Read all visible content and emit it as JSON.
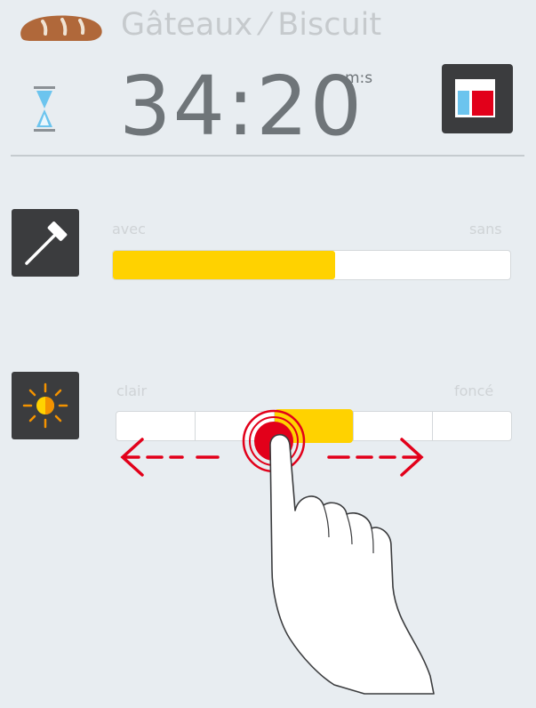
{
  "header": {
    "program_icon": "bread-icon",
    "program_title": "Gâteaux ⁄ Biscuit"
  },
  "timer": {
    "icon": "hourglass-icon",
    "value": "34:20",
    "unit": "m:s"
  },
  "view_button_icon": "split-view-icon",
  "probe": {
    "icon": "probe-icon",
    "left_label": "avec",
    "right_label": "sans",
    "level_fraction": 0.56
  },
  "browning": {
    "icon": "sun-half-icon",
    "left_label": "clair",
    "right_label": "foncé",
    "segments": 5,
    "active_segment": 2
  },
  "gesture": {
    "hand_icon": "pointing-hand-icon",
    "arrows_icon": "swipe-left-right-arrows-icon"
  },
  "colors": {
    "accent": "#ffd200",
    "touch_red": "#e2001a",
    "tile_dark": "#3b3c3e",
    "sun_orange": "#f39200",
    "hourglass_blue": "#6cc4ee"
  }
}
